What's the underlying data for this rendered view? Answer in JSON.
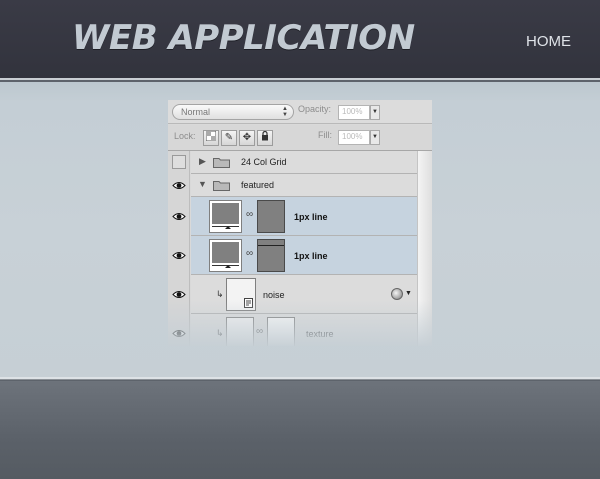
{
  "header": {
    "logo": "WEB APPLICATION",
    "nav": {
      "home": "HOME"
    }
  },
  "layers_panel": {
    "blend_mode": "Normal",
    "opacity_label": "Opacity:",
    "opacity_value": "100%",
    "lock_label": "Lock:",
    "fill_label": "Fill:",
    "fill_value": "100%",
    "layers": [
      {
        "name": "24 Col Grid",
        "type": "group",
        "visible": false,
        "expanded": false
      },
      {
        "name": "featured",
        "type": "group",
        "visible": true,
        "expanded": true
      },
      {
        "name": "1px line",
        "type": "layer",
        "visible": true,
        "selected": true
      },
      {
        "name": "1px line",
        "type": "layer",
        "visible": true,
        "selected": true
      },
      {
        "name": "noise",
        "type": "layer",
        "visible": true,
        "selected": false
      },
      {
        "name": "texture",
        "type": "layer",
        "visible": true,
        "selected": false
      }
    ]
  },
  "colors": {
    "header_bg": "#35363f",
    "band_bg": "#c6cfd5",
    "footer_bg": "#5d636b",
    "selected_layer": "#c6d3df"
  }
}
